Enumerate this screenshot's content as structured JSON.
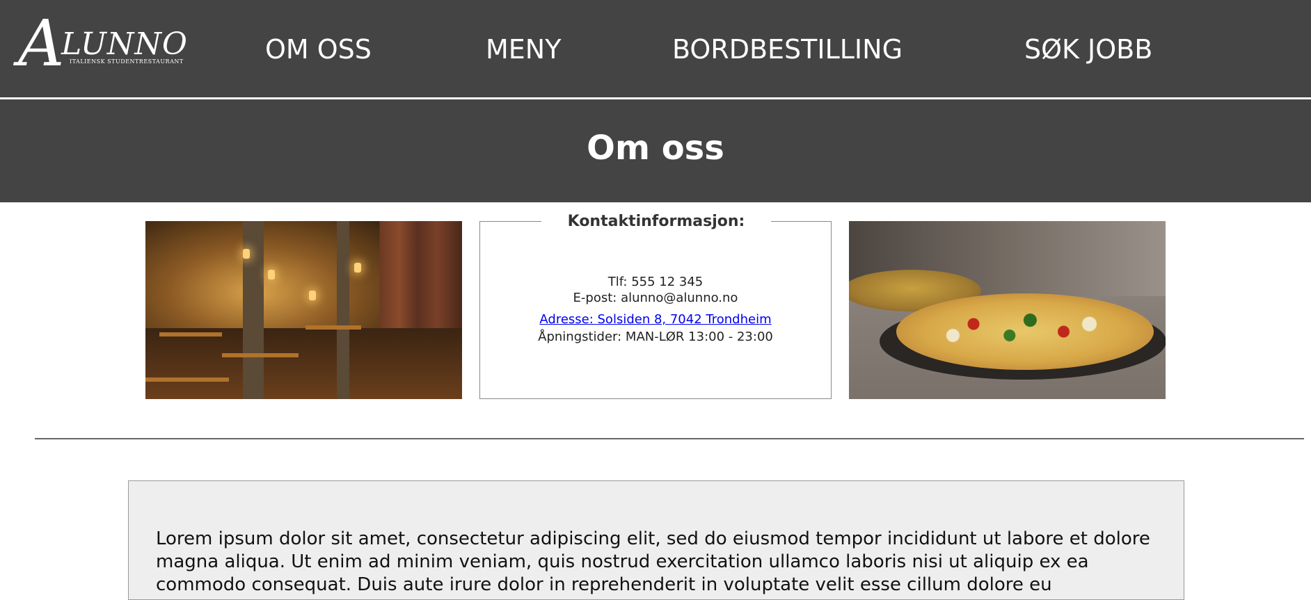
{
  "header": {
    "logo": {
      "initial": "A",
      "rest": "LUNNO",
      "tagline": "ITALIENSK STUDENTRESTAURANT"
    },
    "nav": [
      {
        "label": "OM OSS"
      },
      {
        "label": "MENY"
      },
      {
        "label": "BORDBESTILLING"
      },
      {
        "label": "SØK JOBB"
      }
    ]
  },
  "hero": {
    "title": "Om oss"
  },
  "contact": {
    "heading": "Kontaktinformasjon:",
    "phone": "Tlf: 555 12 345",
    "email": "E-post: alunno@alunno.no",
    "address": "Adresse: Solsiden 8, 7042 Trondheim",
    "hours": "Åpningstider: MAN-LØR 13:00 - 23:00"
  },
  "images": [
    {
      "name": "restaurant-interior"
    },
    {
      "name": "pizza-in-oven"
    }
  ],
  "about": {
    "text": "Lorem ipsum dolor sit amet, consectetur adipiscing elit, sed do eiusmod tempor incididunt ut labore et dolore magna aliqua. Ut enim ad minim veniam, quis nostrud exercitation ullamco laboris nisi ut aliquip ex ea commodo consequat. Duis aute irure dolor in reprehenderit in voluptate velit esse cillum dolore eu"
  },
  "colors": {
    "header_bg": "#444444",
    "link": "#0000ee",
    "box_bg": "#eeeeee"
  }
}
